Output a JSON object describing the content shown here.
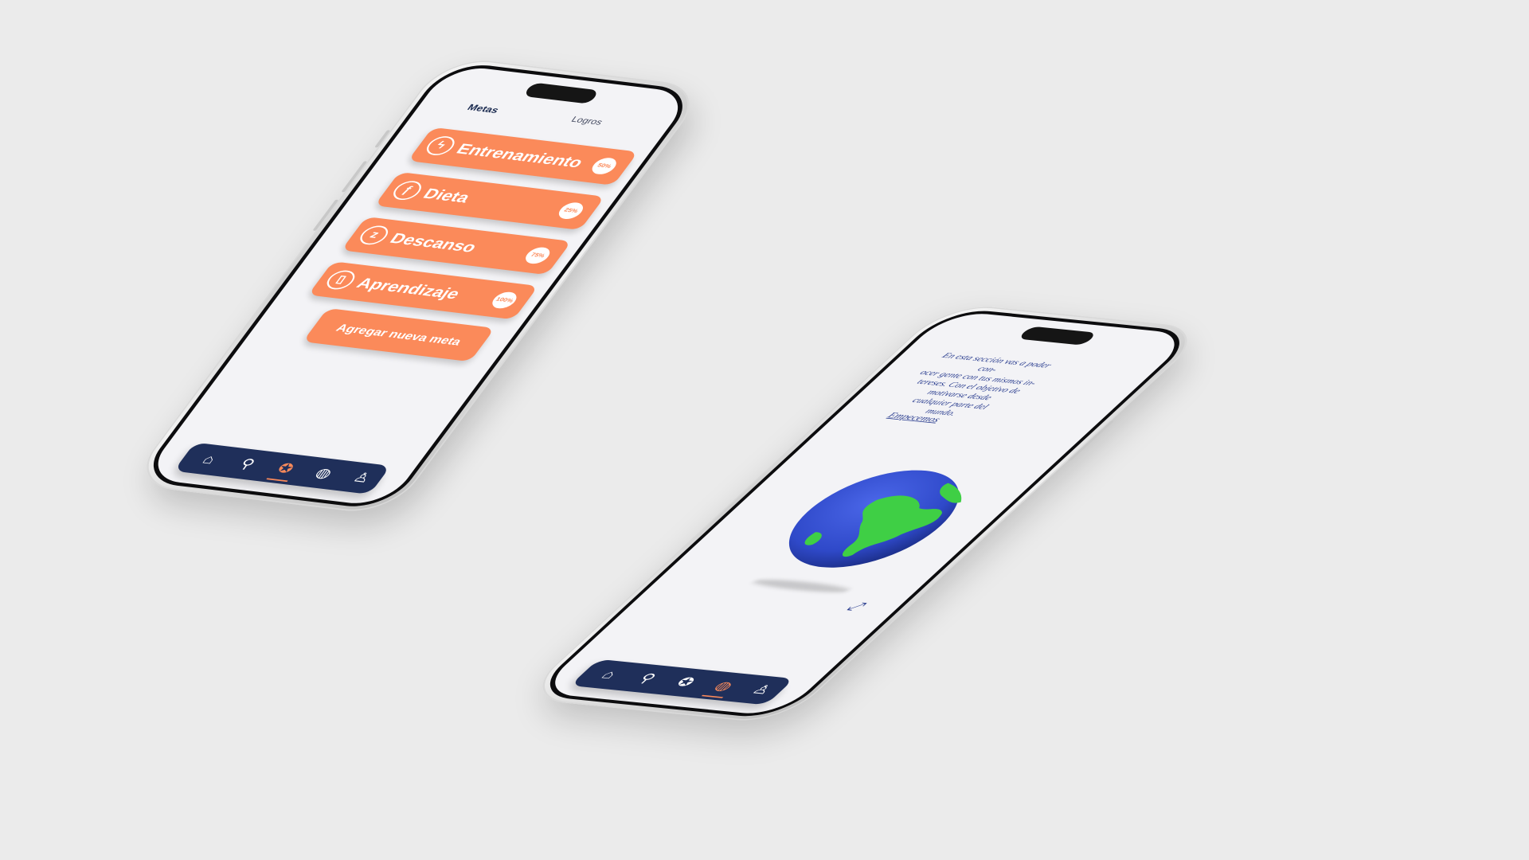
{
  "colors": {
    "background": "#ebebeb",
    "accent": "#fb8a5a",
    "navbar": "#1f2f5a",
    "text_blue": "#2a3d8f",
    "globe_ocean": "#2f49c9",
    "globe_land": "#3fcf45"
  },
  "goals_screen": {
    "tabs": [
      "Metas",
      "Logros"
    ],
    "goals": [
      {
        "label": "Entrenamiento",
        "percent": "50%",
        "icon": "lightning-icon"
      },
      {
        "label": "Dieta",
        "percent": "25%",
        "icon": "cutlery-icon"
      },
      {
        "label": "Descanso",
        "percent": "75%",
        "icon": "sleep-icon"
      },
      {
        "label": "Aprendizaje",
        "percent": "100%",
        "icon": "book-icon"
      }
    ],
    "add_button": "Agregar nueva meta",
    "nav": [
      "home-icon",
      "search-icon",
      "goals-badge-icon",
      "globe-icon",
      "profile-icon"
    ],
    "active_nav": "goals-badge-icon"
  },
  "community_screen": {
    "description_lines": [
      "En esta sección vas  a poder con-",
      "ocer  gente con tus  mismos  in-",
      "tereses.  Con el objetivo de",
      "motivarse desde",
      "cualquier parte del",
      "mundo."
    ],
    "cta": "Empecemos",
    "nav": [
      "home-icon",
      "search-icon",
      "goals-badge-icon",
      "globe-icon",
      "profile-icon"
    ],
    "active_nav": "globe-icon"
  }
}
